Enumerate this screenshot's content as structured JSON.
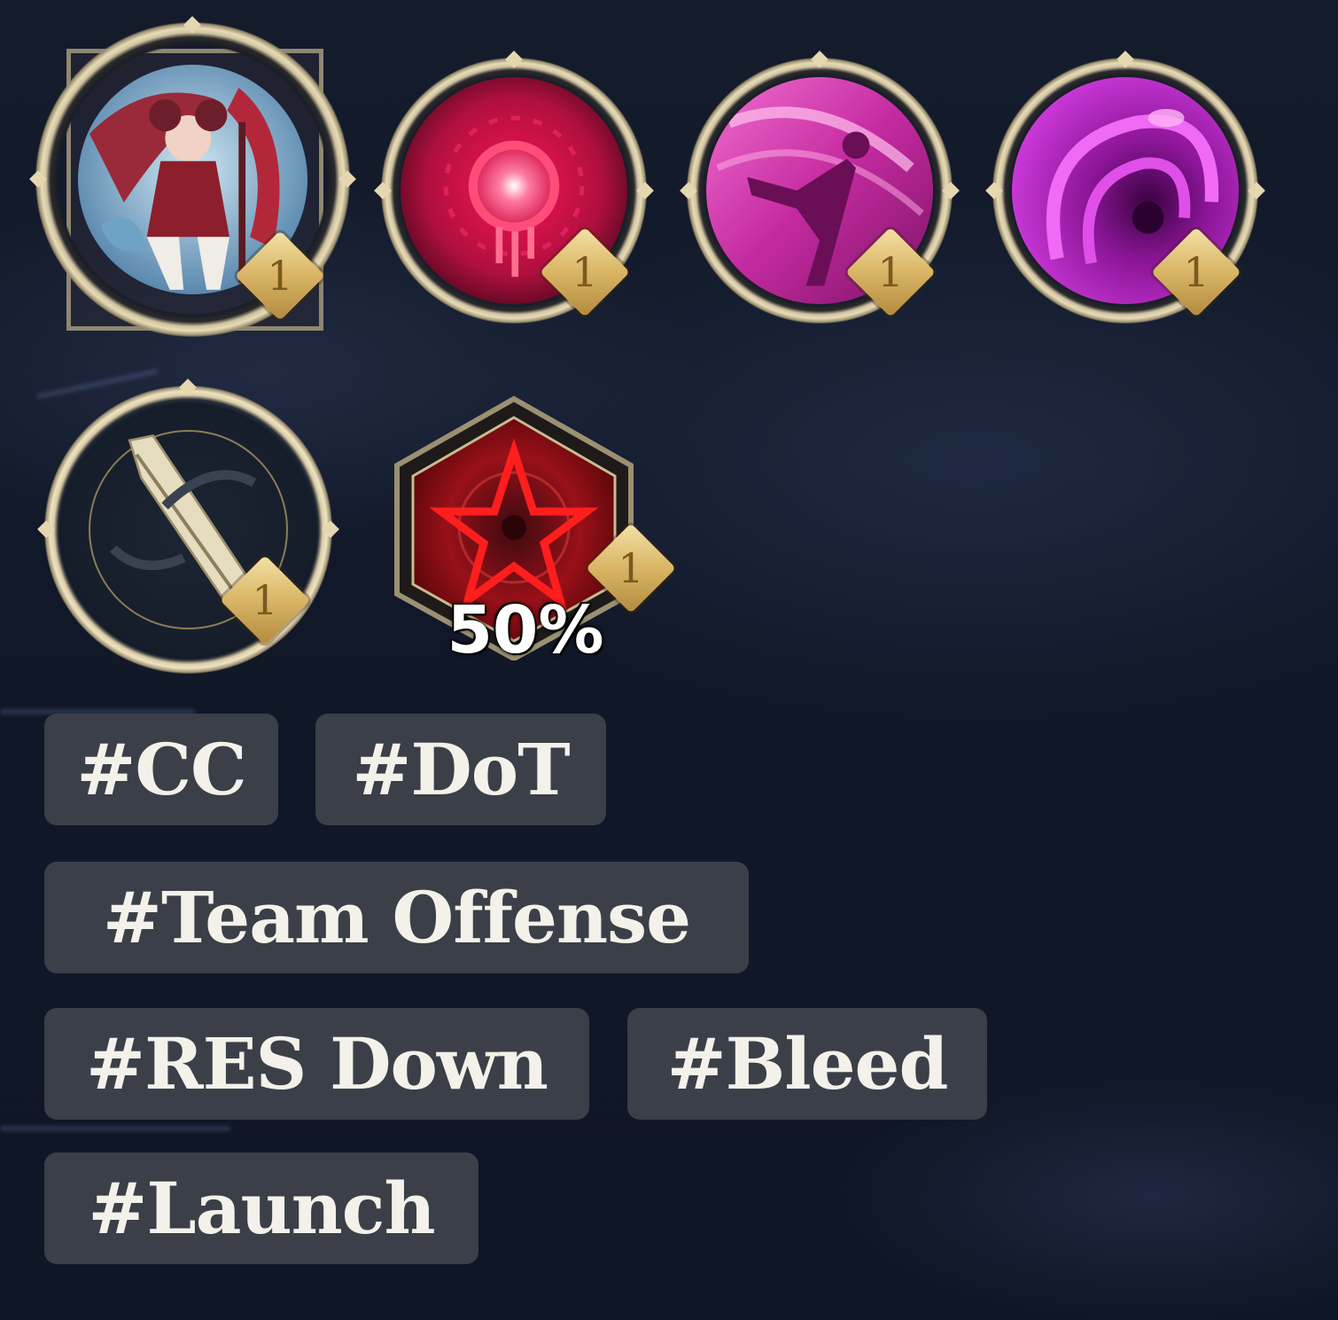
{
  "skills": [
    {
      "icon": "character-portrait-icon",
      "level": "1"
    },
    {
      "icon": "crimson-burst-icon",
      "level": "1"
    },
    {
      "icon": "launch-kick-icon",
      "level": "1"
    },
    {
      "icon": "purple-vortex-icon",
      "level": "1"
    }
  ],
  "weapon": {
    "icon": "sword-icon",
    "level": "1"
  },
  "sigil": {
    "icon": "pentagram-icon",
    "level": "1",
    "percent": "50%"
  },
  "tags": [
    "#CC",
    "#DoT",
    "#Team Offense",
    "#RES Down",
    "#Bleed",
    "#Launch"
  ],
  "colors": {
    "background": "#121a2b",
    "tag_bg": "#3b3f48",
    "tag_text": "#f3f1ea",
    "badge_gold": "#d9b565",
    "ring_gold": "#e8dcb8"
  }
}
